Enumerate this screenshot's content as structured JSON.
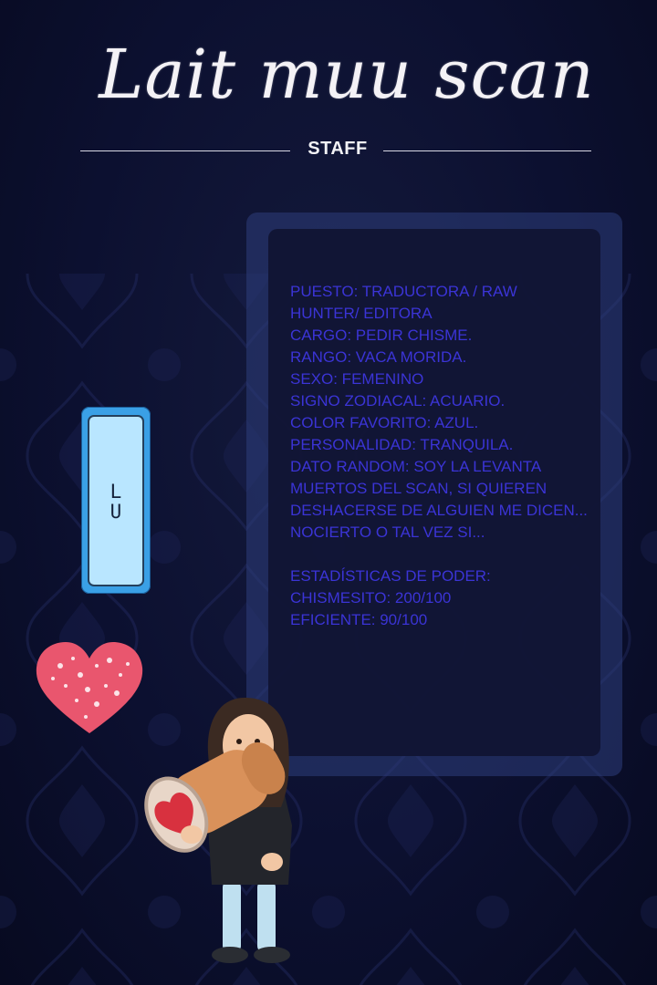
{
  "header": {
    "logo_text": "Lait muu scan",
    "section_label": "STAFF"
  },
  "member": {
    "name_vertical": "L\nU",
    "info_lines": [
      "PUESTO: TRADUCTORA / RAW",
      "HUNTER/ EDITORA",
      "CARGO: PEDIR CHISME.",
      "RANGO: VACA MORIDA.",
      "SEXO: FEMENINO",
      "SIGNO ZODIACAL: ACUARIO.",
      "COLOR FAVORITO: AZUL.",
      "PERSONALIDAD: TRANQUILA.",
      "DATO RANDOM: SOY LA LEVANTA",
      "MUERTOS DEL SCAN, SI QUIEREN",
      "DESHACERSE DE ALGUIEN ME DICEN...",
      "NOCIERTO O TAL VEZ SI..."
    ],
    "stats_title": "ESTADÍSTICAS DE PODER:",
    "stats": [
      "CHISMESITO: 200/100",
      "EFICIENTE: 90/100"
    ]
  },
  "colors": {
    "info_text": "#3b34d6",
    "name_card": "#b9e6ff",
    "name_frame": "#3aa0e6",
    "heart": "#e9566e"
  },
  "icons": [
    "heart-sticker-icon",
    "avatar-sticker"
  ]
}
